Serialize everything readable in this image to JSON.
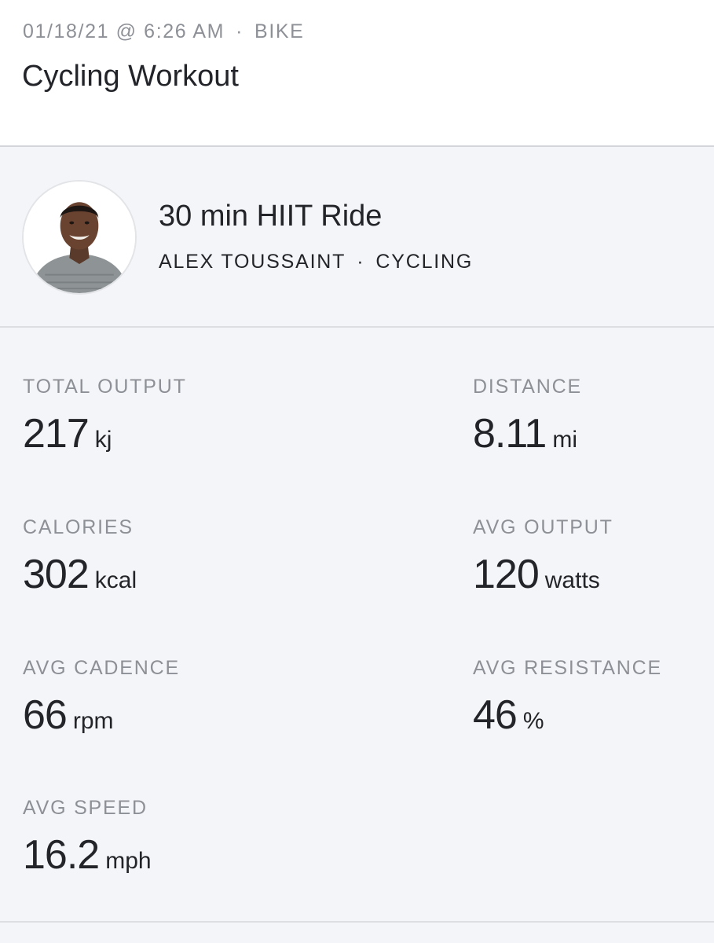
{
  "workout": {
    "date_time": "01/18/21 @ 6:26 AM",
    "separator": "·",
    "platform": "BIKE",
    "title": "Cycling Workout"
  },
  "class": {
    "title": "30 min HIIT Ride",
    "instructor": "ALEX TOUSSAINT",
    "separator": "·",
    "discipline": "CYCLING"
  },
  "stats": [
    {
      "label": "TOTAL OUTPUT",
      "value": "217",
      "unit": "kj"
    },
    {
      "label": "DISTANCE",
      "value": "8.11",
      "unit": "mi"
    },
    {
      "label": "CALORIES",
      "value": "302",
      "unit": "kcal"
    },
    {
      "label": "AVG OUTPUT",
      "value": "120",
      "unit": "watts"
    },
    {
      "label": "AVG CADENCE",
      "value": "66",
      "unit": "rpm"
    },
    {
      "label": "AVG RESISTANCE",
      "value": "46",
      "unit": "%"
    },
    {
      "label": "AVG SPEED",
      "value": "16.2",
      "unit": "mph"
    }
  ],
  "colors": {
    "background": "#f4f5f8",
    "header_background": "#ffffff",
    "label_gray": "#8d9096",
    "text_dark": "#222429"
  }
}
